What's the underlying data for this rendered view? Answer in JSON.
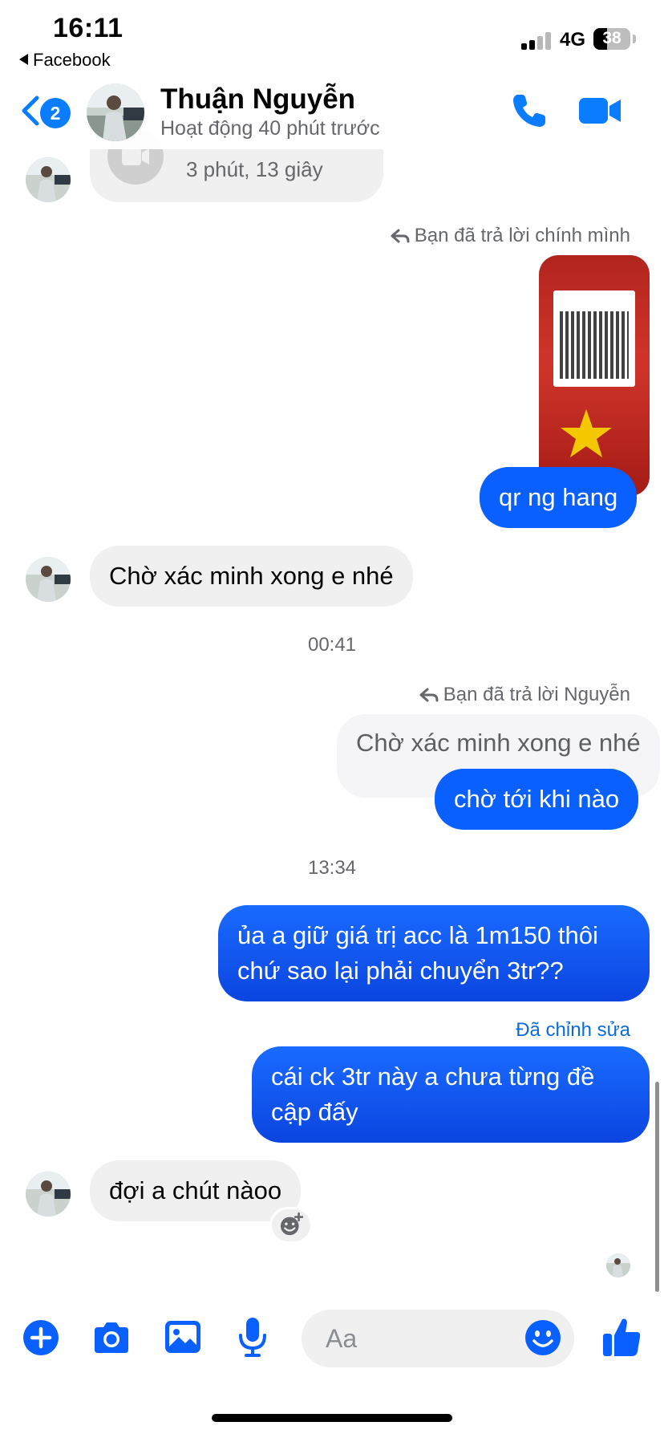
{
  "status_bar": {
    "time": "16:11",
    "back_app": "Facebook",
    "network": "4G",
    "battery": "38",
    "battery_level": 0.38
  },
  "header": {
    "unread_count": "2",
    "contact_name": "Thuận Nguyễn",
    "contact_status": "Hoạt động 40 phút trước",
    "accent_color": "#0a7cff"
  },
  "messages": {
    "call_duration": "3 phút, 13 giây",
    "reply_note_1": "Bạn đã trả lời chính mình",
    "out_1": "qr ng hang",
    "in_1": "Chờ xác minh xong e nhé",
    "time_1": "00:41",
    "reply_note_2": "Bạn đã trả lời Nguyễn",
    "quoted_2": "Chờ xác minh xong e nhé",
    "out_2": "chờ tới khi nào",
    "time_2": "13:34",
    "out_3_line1": "ủa a giữ giá trị acc là 1m150 thôi",
    "out_3_line2": "chứ sao lại phải chuyển 3tr??",
    "edited_label": "Đã chỉnh sửa",
    "out_4_line1": "cái ck 3tr này a chưa từng đề",
    "out_4_line2": "cập đấy",
    "in_2": "đợi a chút nàoo"
  },
  "composer": {
    "placeholder": "Aa"
  },
  "icons": {
    "back": "chevron-left-icon",
    "call": "phone-icon",
    "video": "video-camera-icon",
    "plus": "plus-circle-icon",
    "camera": "camera-icon",
    "gallery": "photo-gallery-icon",
    "mic": "microphone-icon",
    "emoji": "smiley-icon",
    "like": "thumbs-up-icon",
    "react": "add-reaction-icon"
  }
}
